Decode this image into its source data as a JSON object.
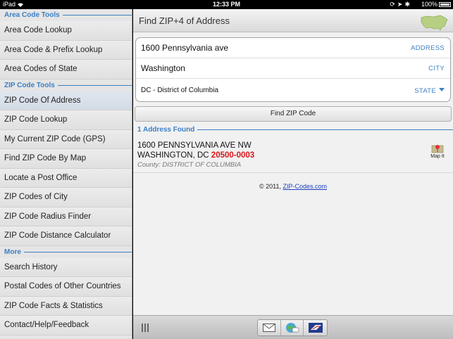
{
  "status_bar": {
    "device": "iPad",
    "time": "12:33 PM",
    "battery": "100%"
  },
  "sidebar": {
    "sections": [
      {
        "header": "Area Code Tools",
        "items": [
          {
            "label": "Area Code Lookup"
          },
          {
            "label": "Area Code & Prefix Lookup"
          },
          {
            "label": "Area Codes of State"
          }
        ]
      },
      {
        "header": "ZIP Code Tools",
        "items": [
          {
            "label": "ZIP Code Of Address",
            "active": true
          },
          {
            "label": "ZIP Code Lookup"
          },
          {
            "label": "My Current ZIP Code (GPS)"
          },
          {
            "label": "Find ZIP Code By Map"
          },
          {
            "label": "Locate a Post Office"
          },
          {
            "label": "ZIP Codes of City"
          },
          {
            "label": "ZIP Code Radius Finder"
          },
          {
            "label": "ZIP Code Distance Calculator"
          }
        ]
      },
      {
        "header": "More",
        "items": [
          {
            "label": "Search History"
          },
          {
            "label": "Postal Codes of Other Countries"
          },
          {
            "label": "ZIP Code Facts & Statistics"
          },
          {
            "label": "Contact/Help/Feedback"
          }
        ]
      }
    ]
  },
  "main": {
    "title": "Find ZIP+4 of Address",
    "form": {
      "address_value": "1600 Pennsylvania ave",
      "address_label": "ADDRESS",
      "city_value": "Washington",
      "city_label": "CITY",
      "state_value": "DC - District of Columbia",
      "state_label": "STATE"
    },
    "find_button": "Find ZIP Code",
    "results_header": "1 Address Found",
    "result": {
      "line1": "1600 PENNSYLVANIA AVE NW",
      "city_state": "WASHINGTON, DC",
      "zip": "20500-0003",
      "county": "County: DISTRICT OF COLUMBIA",
      "map_it": "Map It"
    },
    "copyright": "© 2011,",
    "copyright_link": "ZIP-Codes.com"
  },
  "colors": {
    "accent": "#3c7fc4",
    "zip_red": "#d8151b",
    "link": "#1a3fbf"
  }
}
